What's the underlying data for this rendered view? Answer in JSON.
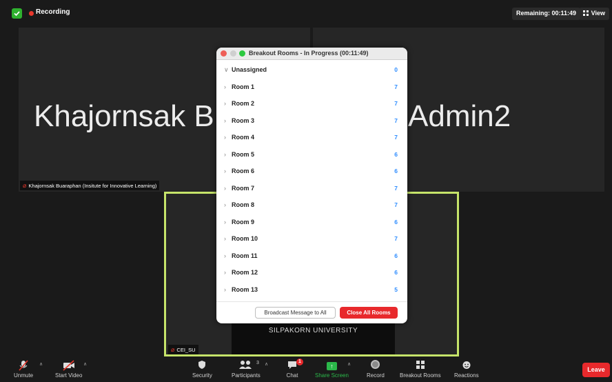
{
  "topbar": {
    "recording_label": "Recording",
    "remaining_label": "Remaining: 00:11:49",
    "view_label": "View",
    "icons": {
      "security": "shield-check-icon",
      "recording": "record-dot-icon",
      "view": "grid-icon"
    }
  },
  "video": {
    "tile1_name": "Khajornsak B",
    "tile2_name": "Admin2",
    "tile1_tag": "Khajornsak Buaraphan (Insitute for Innovative Learning)",
    "active_tag": "CEI_SU",
    "active_video_text": "SILPAKORN UNIVERSITY",
    "active_border_color": "#c6e46a"
  },
  "breakout_panel": {
    "title": "Breakout Rooms - In Progress (00:11:49)",
    "rooms": [
      {
        "name": "Unassigned",
        "count": "0",
        "expanded": true
      },
      {
        "name": "Room 1",
        "count": "7"
      },
      {
        "name": "Room 2",
        "count": "7"
      },
      {
        "name": "Room 3",
        "count": "7"
      },
      {
        "name": "Room 4",
        "count": "7"
      },
      {
        "name": "Room 5",
        "count": "6"
      },
      {
        "name": "Room 6",
        "count": "6"
      },
      {
        "name": "Room 7",
        "count": "7"
      },
      {
        "name": "Room 8",
        "count": "7"
      },
      {
        "name": "Room 9",
        "count": "6"
      },
      {
        "name": "Room 10",
        "count": "7"
      },
      {
        "name": "Room 11",
        "count": "6"
      },
      {
        "name": "Room 12",
        "count": "6"
      },
      {
        "name": "Room 13",
        "count": "5"
      }
    ],
    "broadcast_label": "Broadcast Message to All",
    "close_label": "Close All Rooms",
    "close_color": "#e8292c",
    "count_color": "#2d8cff"
  },
  "toolbar": {
    "unmute": "Unmute",
    "start_video": "Start Video",
    "security": "Security",
    "participants": "Participants",
    "participants_count": "3",
    "chat": "Chat",
    "chat_badge": "1",
    "share_screen": "Share Screen",
    "record": "Record",
    "breakout_rooms": "Breakout Rooms",
    "reactions": "Reactions",
    "leave": "Leave",
    "share_color": "#2bb84a"
  }
}
